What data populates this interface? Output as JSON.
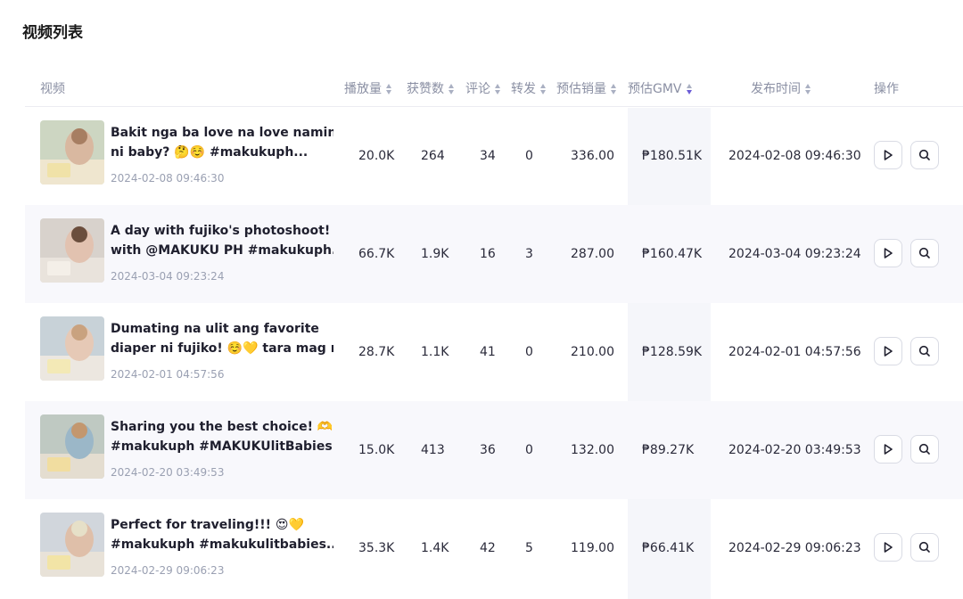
{
  "page": {
    "title": "视频列表"
  },
  "table": {
    "headers": {
      "video": "视频",
      "plays": "播放量",
      "likes": "获赞数",
      "comments": "评论",
      "shares": "转发",
      "sales": "预估销量",
      "gmv": "预估GMV",
      "publish_time": "发布时间",
      "actions": "操作"
    },
    "sorted_column": "gmv",
    "rows": [
      {
        "title_line1": "Bakit nga ba love na love namin to",
        "title_line2": "ni baby? 🤔☺️ #makukuph...",
        "date": "2024-02-08 09:46:30",
        "plays": "20.0K",
        "likes": "264",
        "comments": "34",
        "shares": "0",
        "sales": "336.00",
        "gmv": "₱180.51K",
        "publish_time": "2024-02-08 09:46:30"
      },
      {
        "title_line1": "A day with fujiko's photoshoot! 📷💕",
        "title_line2": "with @MAKUKU PH #makukuph...",
        "date": "2024-03-04 09:23:24",
        "plays": "66.7K",
        "likes": "1.9K",
        "comments": "16",
        "shares": "3",
        "sales": "287.00",
        "gmv": "₱160.47K",
        "publish_time": "2024-03-04 09:23:24"
      },
      {
        "title_line1": "Dumating na ulit ang favorite",
        "title_line2": "diaper ni fujiko! ☺️💛 tara mag re...",
        "date": "2024-02-01 04:57:56",
        "plays": "28.7K",
        "likes": "1.1K",
        "comments": "41",
        "shares": "0",
        "sales": "210.00",
        "gmv": "₱128.59K",
        "publish_time": "2024-02-01 04:57:56"
      },
      {
        "title_line1": "Sharing you the best choice! 🫶💯",
        "title_line2": "#makukuph #MAKUKUlitBabies...",
        "date": "2024-02-20 03:49:53",
        "plays": "15.0K",
        "likes": "413",
        "comments": "36",
        "shares": "0",
        "sales": "132.00",
        "gmv": "₱89.27K",
        "publish_time": "2024-02-20 03:49:53"
      },
      {
        "title_line1": "Perfect for traveling!!! 😍💛",
        "title_line2": "#makukuph #makukulitbabies...",
        "date": "2024-02-29 09:06:23",
        "plays": "35.3K",
        "likes": "1.4K",
        "comments": "42",
        "shares": "5",
        "sales": "119.00",
        "gmv": "₱66.41K",
        "publish_time": "2024-02-29 09:06:23"
      }
    ]
  },
  "icons": {
    "play": "play-icon",
    "search": "search-icon",
    "sort": "sort-icon"
  },
  "colors": {
    "accent": "#6b5cd6",
    "header_text": "#8a8fa3",
    "gmv_band": "#f5f6fa"
  }
}
